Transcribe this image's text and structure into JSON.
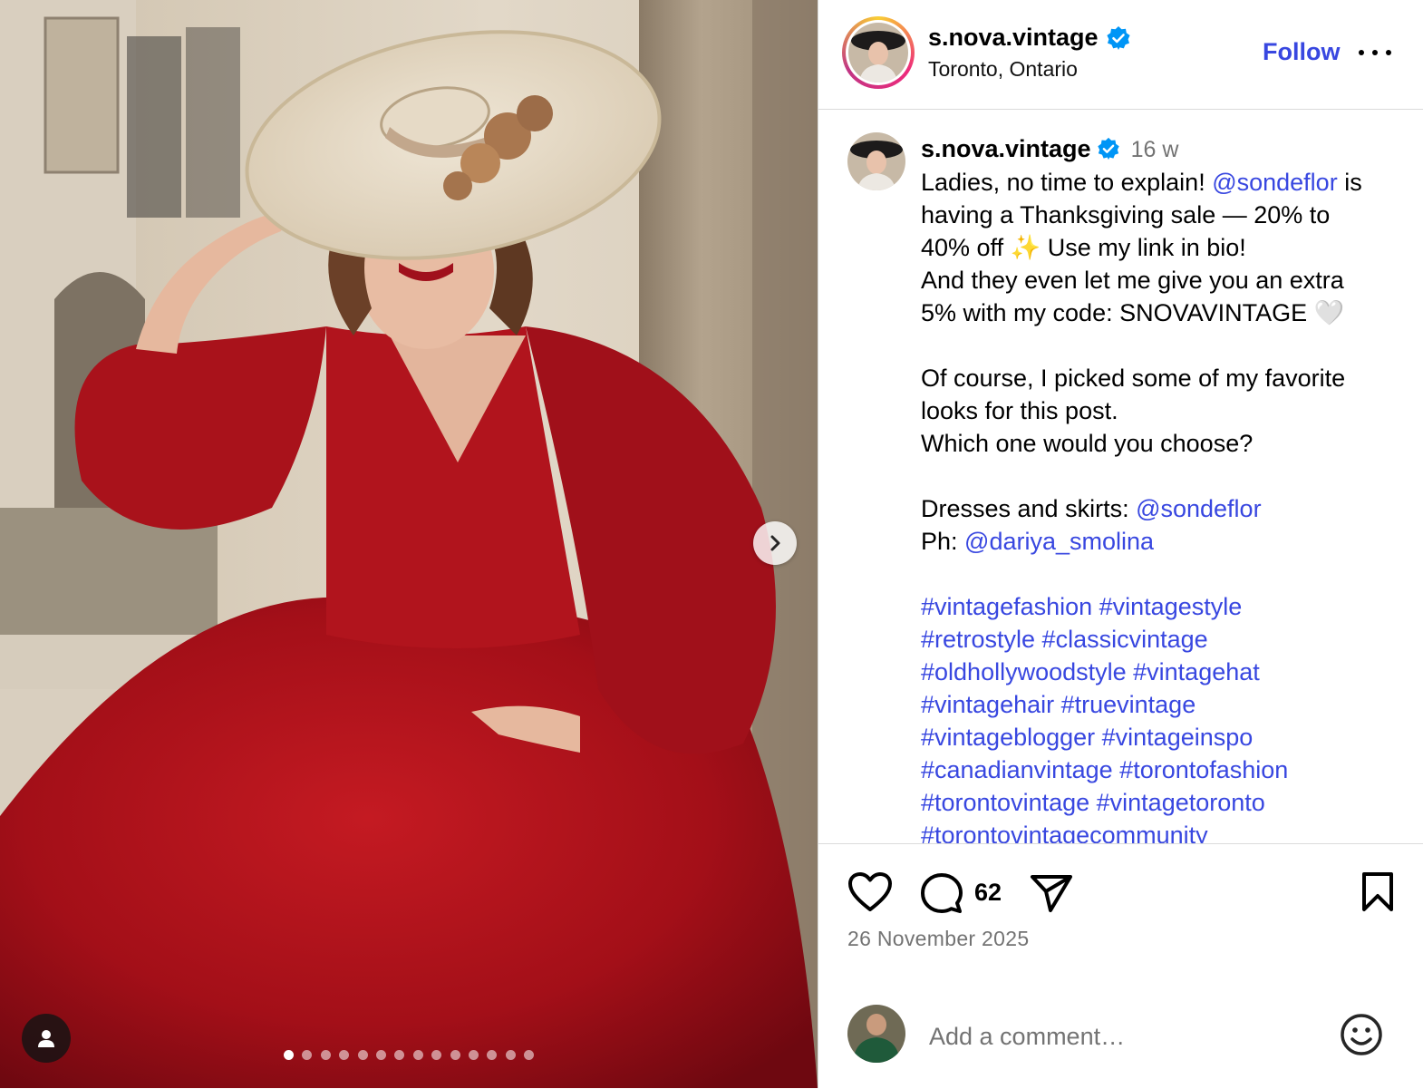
{
  "account": {
    "username": "s.nova.vintage",
    "location": "Toronto, Ontario",
    "verified_icon": "verified-badge-icon",
    "follow_label": "Follow"
  },
  "carousel": {
    "slide_count": 14,
    "active_index": 0
  },
  "caption": {
    "username": "s.nova.vintage",
    "time": "16 w",
    "l1a": "Ladies, no time to explain! ",
    "l1_mention": "@sondeflor",
    "l1b": " is",
    "l2": "having a Thanksgiving sale — 20% to",
    "l3": "40% off ✨ Use my link in bio!",
    "l4": "And they even let me give you an extra",
    "l5": "5% with my code: SNOVAVINTAGE 🤍",
    "l6": "Of course, I picked some of my favorite",
    "l7": "looks for this post.",
    "l8": "Which one would you choose?",
    "l9a": "Dresses and skirts: ",
    "l9_mention": "@sondeflor",
    "l10a": "Ph: ",
    "l10_mention": "@dariya_smolina",
    "hashtags": [
      "#vintagefashion #vintagestyle",
      "#retrostyle #classicvintage",
      "#oldhollywoodstyle #vintagehat",
      "#vintagehair #truevintage",
      "#vintageblogger #vintageinspo",
      "#canadianvintage #torontofashion",
      "#torontovintage #vintagetoronto",
      "#torontovintagecommunity"
    ]
  },
  "actions": {
    "comment_count": "62",
    "date": "26 November 2025"
  },
  "add_comment": {
    "placeholder": "Add a comment…"
  },
  "colors": {
    "link": "#3847e0",
    "verified": "#0095f6",
    "muted": "#737373",
    "dress": "#a8101a"
  }
}
